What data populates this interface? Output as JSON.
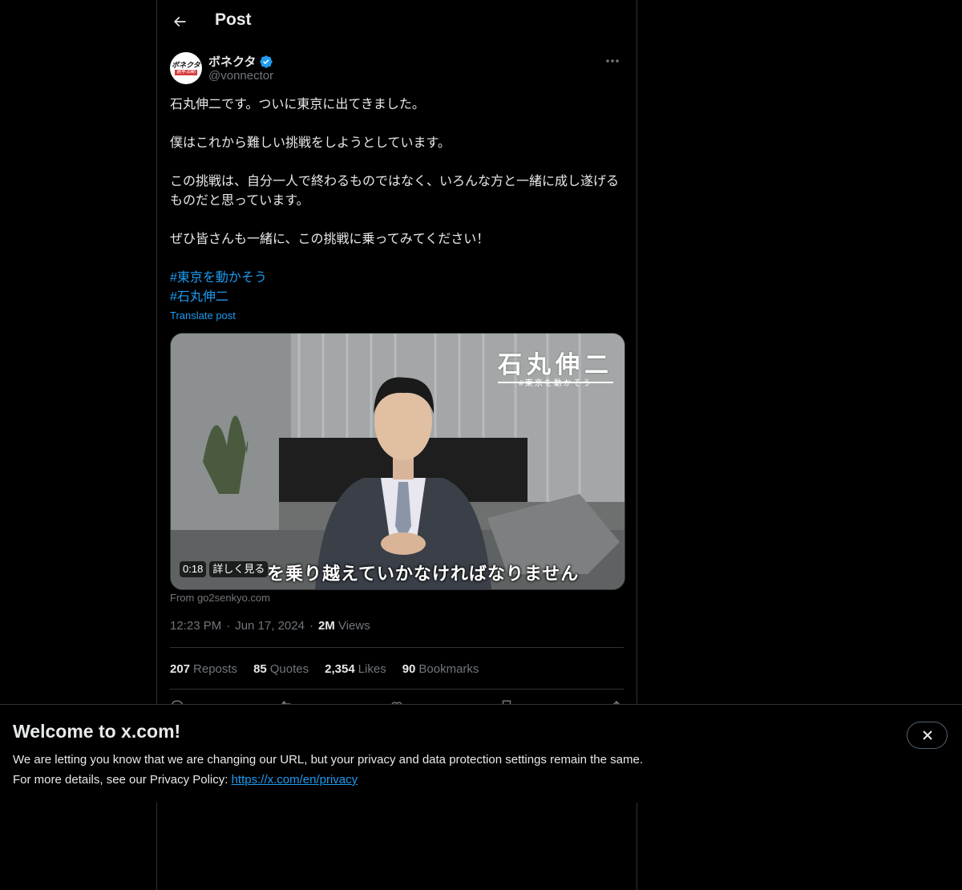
{
  "header": {
    "title": "Post"
  },
  "author": {
    "avatar_text": "ボネクタ",
    "avatar_sub": "選挙活動",
    "display_name": "ボネクタ",
    "handle": "@vonnector",
    "verified": true
  },
  "tweet": {
    "paragraphs": [
      "石丸伸二です。ついに東京に出てきました。",
      "僕はこれから難しい挑戦をしようとしています。",
      "この挑戦は、自分一人で終わるものではなく、いろんな方と一緒に成し遂げるものだと思っています。",
      "ぜひ皆さんも一緒に、この挑戦に乗ってみてください！"
    ],
    "hashtags": [
      "#東京を動かそう",
      "#石丸伸二"
    ],
    "translate_label": "Translate post"
  },
  "media": {
    "name_title": "石丸伸二",
    "name_sub": "#東京を動かそう",
    "subtitle": "を乗り越えていかなければなりません",
    "duration": "0:18",
    "details_label": "詳しく見る",
    "source": "From go2senkyo.com"
  },
  "meta": {
    "time": "12:23 PM",
    "date": "Jun 17, 2024",
    "views_count": "2M",
    "views_label": "Views"
  },
  "stats": {
    "reposts_count": "207",
    "reposts_label": "Reposts",
    "quotes_count": "85",
    "quotes_label": "Quotes",
    "likes_count": "2,354",
    "likes_label": "Likes",
    "bookmarks_count": "90",
    "bookmarks_label": "Bookmarks"
  },
  "banner": {
    "title": "Welcome to x.com!",
    "line1": "We are letting you know that we are changing our URL, but your privacy and data protection settings remain the same.",
    "line2_prefix": "For more details, see our Privacy Policy: ",
    "link": "https://x.com/en/privacy"
  },
  "colors": {
    "background": "#000000",
    "text": "#e7e9ea",
    "muted": "#71767b",
    "accent": "#1d9bf0",
    "border": "#2f3336"
  },
  "icons": [
    "back-arrow-icon",
    "verified-badge-icon",
    "more-icon",
    "close-icon",
    "reply-icon",
    "repost-icon",
    "like-icon",
    "bookmark-icon",
    "share-icon"
  ]
}
